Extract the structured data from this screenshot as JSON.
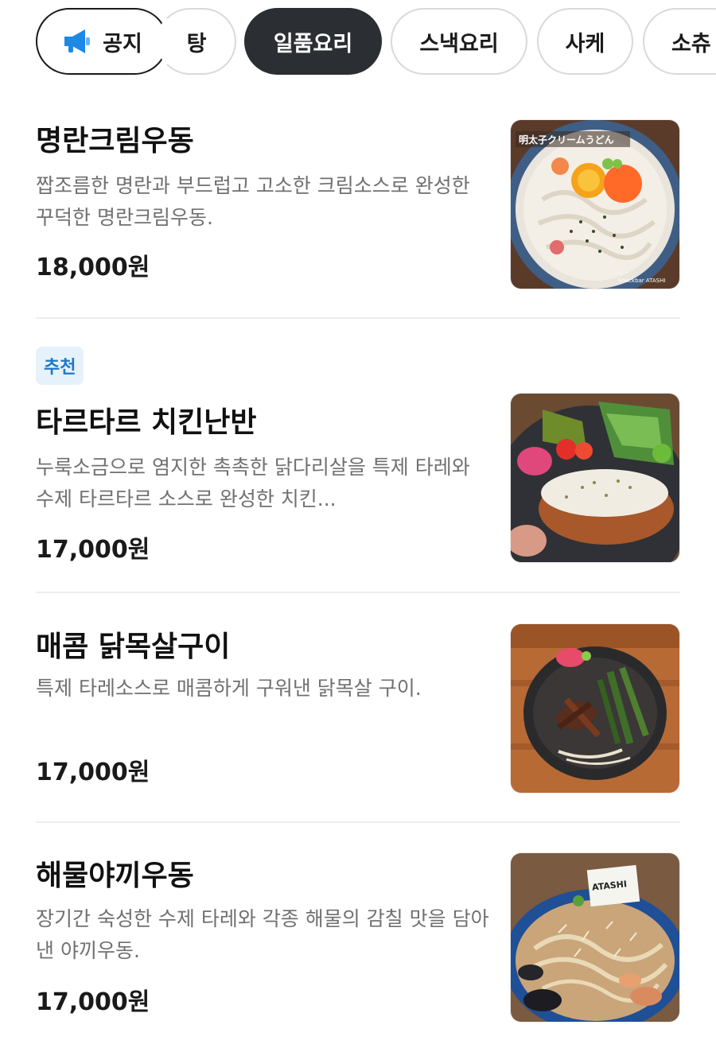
{
  "categories": [
    {
      "label": "공지",
      "icon": "megaphone-icon",
      "state": "notice"
    },
    {
      "label": "탕",
      "state": "normal"
    },
    {
      "label": "일품요리",
      "state": "active"
    },
    {
      "label": "스낵요리",
      "state": "normal"
    },
    {
      "label": "사케",
      "state": "normal"
    },
    {
      "label": "소츄",
      "state": "normal"
    }
  ],
  "items": [
    {
      "name": "명란크림우동",
      "description": "짭조름한 명란과 부드럽고 고소한 크림소스로 완성한 꾸덕한 명란크림우동.",
      "price": "18,000원",
      "image_overlay_text": "明太子クリームうどん",
      "image_watermark": "Snackbar ATASHI"
    },
    {
      "badge": "추천",
      "name": "타르타르 치킨난반",
      "description": "누룩소금으로 염지한 촉촉한 닭다리살을 특제 타레와 수제 타르타르 소스로 완성한 치킨...",
      "price": "17,000원"
    },
    {
      "name": "매콤 닭목살구이",
      "description": "특제 타레소스로 매콤하게 구워낸 닭목살 구이.",
      "price": "17,000원"
    },
    {
      "name": "해물야끼우동",
      "description": "장기간 숙성한 수제 타레와 각종 해물의 감칠 맛을 담아낸 야끼우동.",
      "price": "17,000원",
      "image_overlay_text": "ATASHI"
    }
  ],
  "colors": {
    "active_chip_bg": "#2b2f33",
    "badge_bg": "#e6f2fb",
    "badge_text": "#1f78c8",
    "notice_icon": "#1e88e5"
  }
}
